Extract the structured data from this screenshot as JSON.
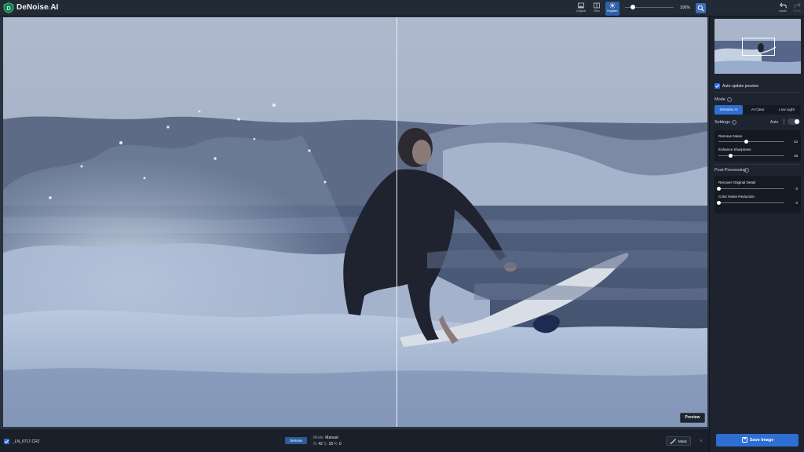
{
  "app": {
    "title": "DeNoise AI",
    "version": "v2.3.3"
  },
  "toolbar": {
    "views": [
      {
        "label": "Original",
        "icon": "image-icon",
        "active": false
      },
      {
        "label": "View",
        "icon": "split-view-icon",
        "active": false
      },
      {
        "label": "Brighten",
        "icon": "brighten-icon",
        "active": true
      }
    ],
    "zoom_value": "100%",
    "zoom_fraction": 0.11,
    "undo_label": "Undo",
    "redo_label": "Redo"
  },
  "canvas": {
    "preview_label": "Preview"
  },
  "bottombar": {
    "file_checked": true,
    "file_name": "_LN_6717.CR2",
    "model_badge": "DeNoise",
    "mode_label": "Mode:",
    "mode_value": "Manual",
    "stats": {
      "n_label": "N:",
      "n_value": "42",
      "s_label": "S:",
      "s_value": "18",
      "r_label": "R:",
      "r_value": "0"
    },
    "mask_label": "Mask",
    "close_symbol": "×"
  },
  "panel": {
    "auto_update_label": "Auto-update preview",
    "auto_update_checked": true,
    "mode_section_label": "Mode",
    "modes": [
      {
        "label": "DeNoise AI",
        "active": true
      },
      {
        "label": "AI Clear",
        "active": false
      },
      {
        "label": "Low Light",
        "active": false
      }
    ],
    "settings_label": "Settings",
    "auto_label": "Auto",
    "auto_enabled": false,
    "settings_sliders": [
      {
        "label": "Remove Noise",
        "value": "42",
        "fraction": 0.42
      },
      {
        "label": "Enhance Sharpness",
        "value": "18",
        "fraction": 0.18
      }
    ],
    "post_processing_label": "Post-Processing",
    "post_sliders": [
      {
        "label": "Recover Original Detail",
        "value": "0",
        "fraction": 0.0
      },
      {
        "label": "Color Noise Reduction",
        "value": "0",
        "fraction": 0.0
      }
    ],
    "save_label": "Save Image"
  },
  "colors": {
    "accent": "#2f6ed3",
    "panel_bg": "#1d242f",
    "topbar_bg": "#222a35"
  }
}
